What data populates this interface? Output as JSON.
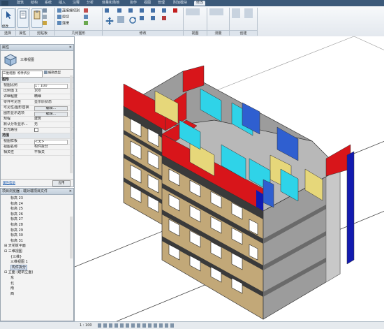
{
  "ribbon": {
    "tabs": [
      "建筑",
      "结构",
      "系统",
      "插入",
      "注释",
      "分析",
      "体量和场地",
      "协作",
      "视图",
      "管理",
      "附加模块",
      "修改"
    ],
    "active_tab_index": 11,
    "modify_label": "修改",
    "groups": [
      "选择",
      "属性",
      "剪贴板",
      "几何图形",
      "修改",
      "视图",
      "测量",
      "创建"
    ],
    "cmd_cut": "剪切",
    "cmd_join": "连接端切割",
    "cmd_join2": "连接",
    "cmd_paste": "粘贴"
  },
  "properties": {
    "header": "属性",
    "type_name": "三维视图",
    "view_selector": "三维视图: 构件拆分",
    "edit_type_label": "编辑类型",
    "section_graphics": "图形",
    "rows": [
      {
        "k": "视图比例",
        "v": "1 : 100"
      },
      {
        "k": "比例值 1:",
        "v": "100"
      },
      {
        "k": "详细程度",
        "v": "精细"
      },
      {
        "k": "零件可见性",
        "v": "显示原状态"
      },
      {
        "k": "可见性/图形替换",
        "v": "编辑..."
      },
      {
        "k": "图形显示选项",
        "v": "编辑..."
      },
      {
        "k": "规程",
        "v": "建筑"
      },
      {
        "k": "默认分析显示...",
        "v": "无"
      },
      {
        "k": "日光路径",
        "v": ""
      }
    ],
    "section_extents": "范围",
    "rows2": [
      {
        "k": "视图样板",
        "v": "<无>"
      },
      {
        "k": "视图名称",
        "v": "构件拆分"
      },
      {
        "k": "相关性",
        "v": "不相关"
      }
    ],
    "help_link": "属性帮助",
    "apply_label": "应用"
  },
  "browser": {
    "header": "项目浏览器 - 端对端项目文件",
    "items": [
      "标高 23",
      "标高 24",
      "标高 25",
      "标高 26",
      "标高 27",
      "标高 28",
      "标高 29",
      "标高 30",
      "标高 31",
      "天花板平面",
      "三维视图",
      "{三维}",
      "三维视图 1",
      "构件拆分",
      "立面 (建筑立面)",
      "东",
      "北",
      "南",
      "西"
    ]
  },
  "statusbar": {
    "scale": "1 : 100"
  },
  "colors": {
    "red": "#d8151a",
    "yellow": "#e6d77a",
    "cyan": "#2fd3e8",
    "blue": "#2f5fd0",
    "navy": "#121ab0",
    "grey": "#9c9c9c",
    "wood": "#c2a878",
    "dark": "#3a3a3a"
  }
}
